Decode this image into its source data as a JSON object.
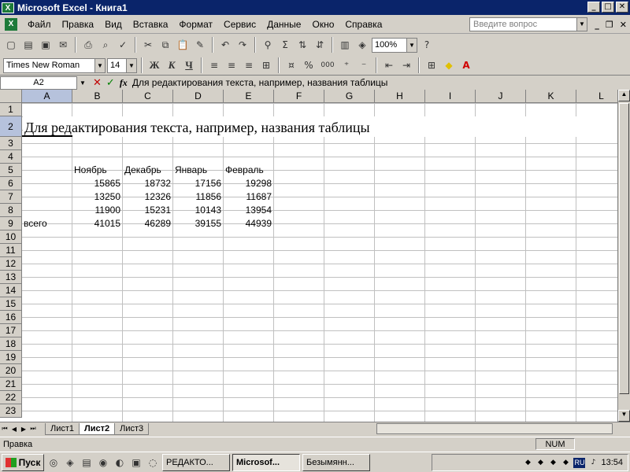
{
  "window": {
    "title": "Microsoft Excel - Книга1"
  },
  "menu": [
    "Файл",
    "Правка",
    "Вид",
    "Вставка",
    "Формат",
    "Сервис",
    "Данные",
    "Окно",
    "Справка"
  ],
  "help_placeholder": "Введите вопрос",
  "toolbar": {
    "zoom": "100%",
    "font_name": "Times New Roman",
    "font_size": "14",
    "bold": "Ж",
    "italic": "К",
    "underline": "Ч",
    "percent": "%",
    "thousands": "000"
  },
  "formula_bar": {
    "name_box": "A2",
    "cancel": "✕",
    "enter": "✓",
    "fx": "fx",
    "content": "Для редактирования текста, например, названия таблицы"
  },
  "grid": {
    "columns": [
      "A",
      "B",
      "C",
      "D",
      "E",
      "F",
      "G",
      "H",
      "I",
      "J",
      "K",
      "L"
    ],
    "rows": [
      "1",
      "2",
      "3",
      "4",
      "5",
      "6",
      "7",
      "8",
      "9",
      "10",
      "11",
      "12",
      "13",
      "14",
      "15",
      "16",
      "17",
      "18",
      "19",
      "20",
      "21",
      "22",
      "23"
    ],
    "title_cell": "Для редактирования текста, например, названия таблицы",
    "header_row": [
      "Ноябрь",
      "Декабрь",
      "Январь",
      "Февраль"
    ],
    "data_rows": [
      {
        "label": "",
        "values": [
          "15865",
          "18732",
          "17156",
          "19298"
        ]
      },
      {
        "label": "",
        "values": [
          "13250",
          "12326",
          "11856",
          "11687"
        ]
      },
      {
        "label": "",
        "values": [
          "11900",
          "15231",
          "10143",
          "13954"
        ]
      },
      {
        "label": "всего",
        "values": [
          "41015",
          "46289",
          "39155",
          "44939"
        ]
      }
    ]
  },
  "sheet_tabs": [
    {
      "label": "Лист1",
      "active": false
    },
    {
      "label": "Лист2",
      "active": true
    },
    {
      "label": "Лист3",
      "active": false
    }
  ],
  "status": {
    "left": "Правка",
    "num": "NUM"
  },
  "taskbar": {
    "start": "Пуск",
    "tasks": [
      {
        "label": "РЕДАКТО...",
        "active": false
      },
      {
        "label": "Microsof...",
        "active": true
      },
      {
        "label": "Безымянн...",
        "active": false
      }
    ],
    "lang": "RU",
    "clock": "13:54"
  }
}
